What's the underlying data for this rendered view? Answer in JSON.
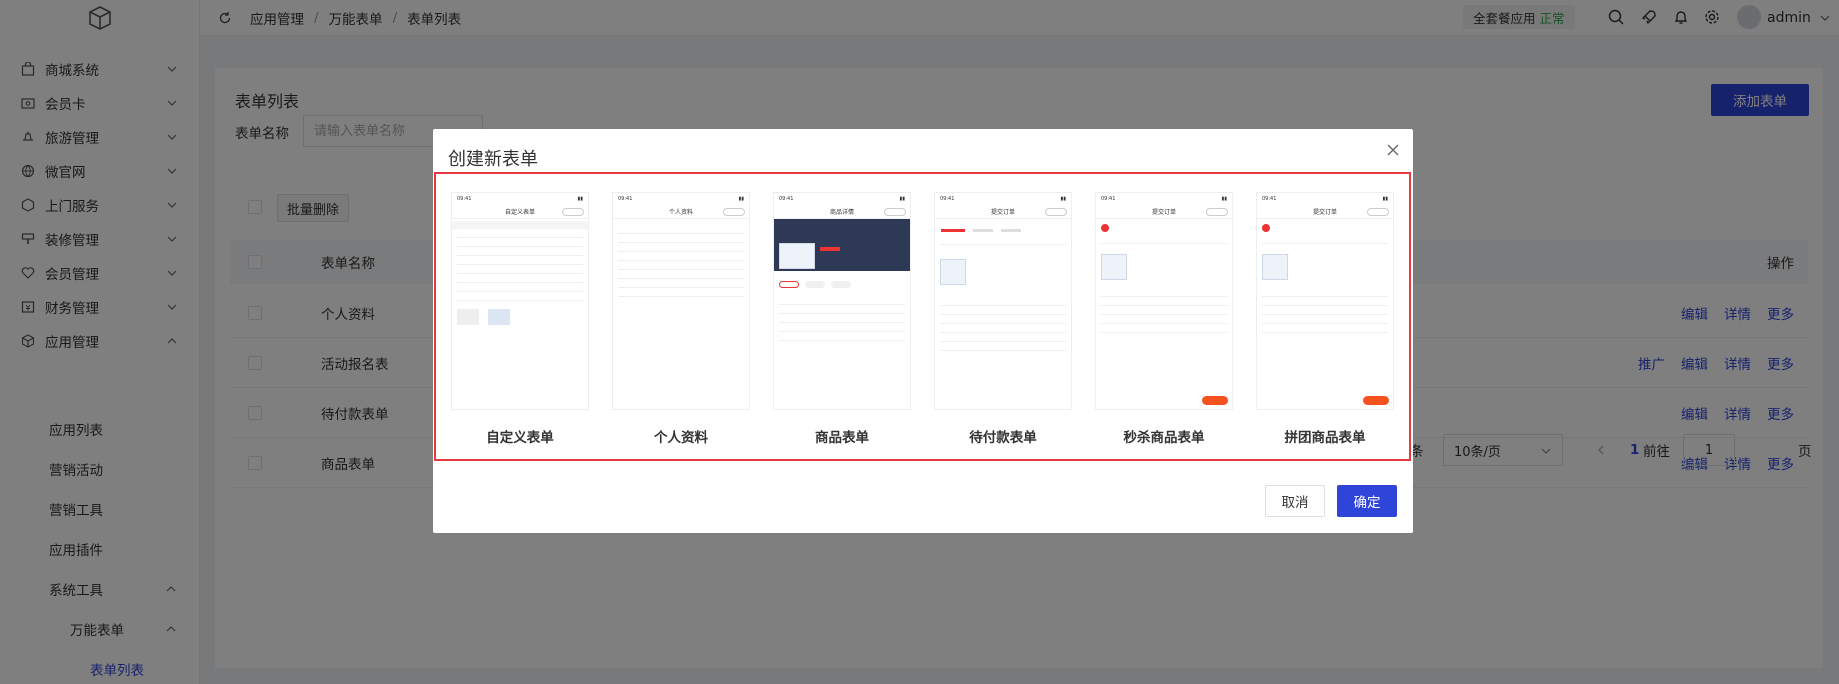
{
  "sidebar": {
    "items": [
      {
        "label": "商城系统",
        "icon": "bag-icon"
      },
      {
        "label": "会员卡",
        "icon": "card-icon"
      },
      {
        "label": "旅游管理",
        "icon": "travel-icon"
      },
      {
        "label": "微官网",
        "icon": "globe-icon"
      },
      {
        "label": "上门服务",
        "icon": "service-icon"
      },
      {
        "label": "装修管理",
        "icon": "decor-icon"
      },
      {
        "label": "会员管理",
        "icon": "heart-icon"
      },
      {
        "label": "财务管理",
        "icon": "finance-icon"
      },
      {
        "label": "应用管理",
        "icon": "app-icon"
      }
    ],
    "sub_items": [
      "应用列表",
      "营销活动",
      "营销工具",
      "应用插件"
    ],
    "system_tools": "系统工具",
    "form_group": "万能表单",
    "form_list": "表单列表"
  },
  "header": {
    "breadcrumb": [
      "应用管理",
      "万能表单",
      "表单列表"
    ],
    "plan_label": "全套餐应用",
    "plan_status": "正常",
    "username": "admin"
  },
  "main": {
    "title": "表单列表",
    "add_button": "添加表单",
    "filter_label": "表单名称",
    "filter_placeholder": "请输入表单名称",
    "bulk_delete": "批量删除",
    "col_name": "表单名称",
    "col_ops": "操作",
    "rows": [
      {
        "name": "个人资料",
        "ops": [
          "编辑",
          "详情",
          "更多"
        ]
      },
      {
        "name": "活动报名表",
        "ops": [
          "推广",
          "编辑",
          "详情",
          "更多"
        ]
      },
      {
        "name": "待付款表单",
        "ops": [
          "编辑",
          "详情",
          "更多"
        ]
      },
      {
        "name": "商品表单",
        "ops": [
          "编辑",
          "详情",
          "更多"
        ]
      }
    ],
    "pager": {
      "total_suffix": "条",
      "page_size": "10条/页",
      "current_page": "1",
      "goto_label": "前往",
      "goto_value": "1",
      "page_suffix": "页"
    }
  },
  "modal": {
    "title": "创建新表单",
    "templates": [
      {
        "label": "自定义表单",
        "screen_title": "自定义表单"
      },
      {
        "label": "个人资料",
        "screen_title": "个人资料"
      },
      {
        "label": "商品表单",
        "screen_title": "商品详情"
      },
      {
        "label": "待付款表单",
        "screen_title": "提交订单"
      },
      {
        "label": "秒杀商品表单",
        "screen_title": "提交订单"
      },
      {
        "label": "拼团商品表单",
        "screen_title": "提交订单"
      }
    ],
    "cancel": "取消",
    "confirm": "确定"
  },
  "colors": {
    "primary": "#2f45d9",
    "highlight_border": "#e5393f",
    "status_ok": "#2ea44f"
  }
}
